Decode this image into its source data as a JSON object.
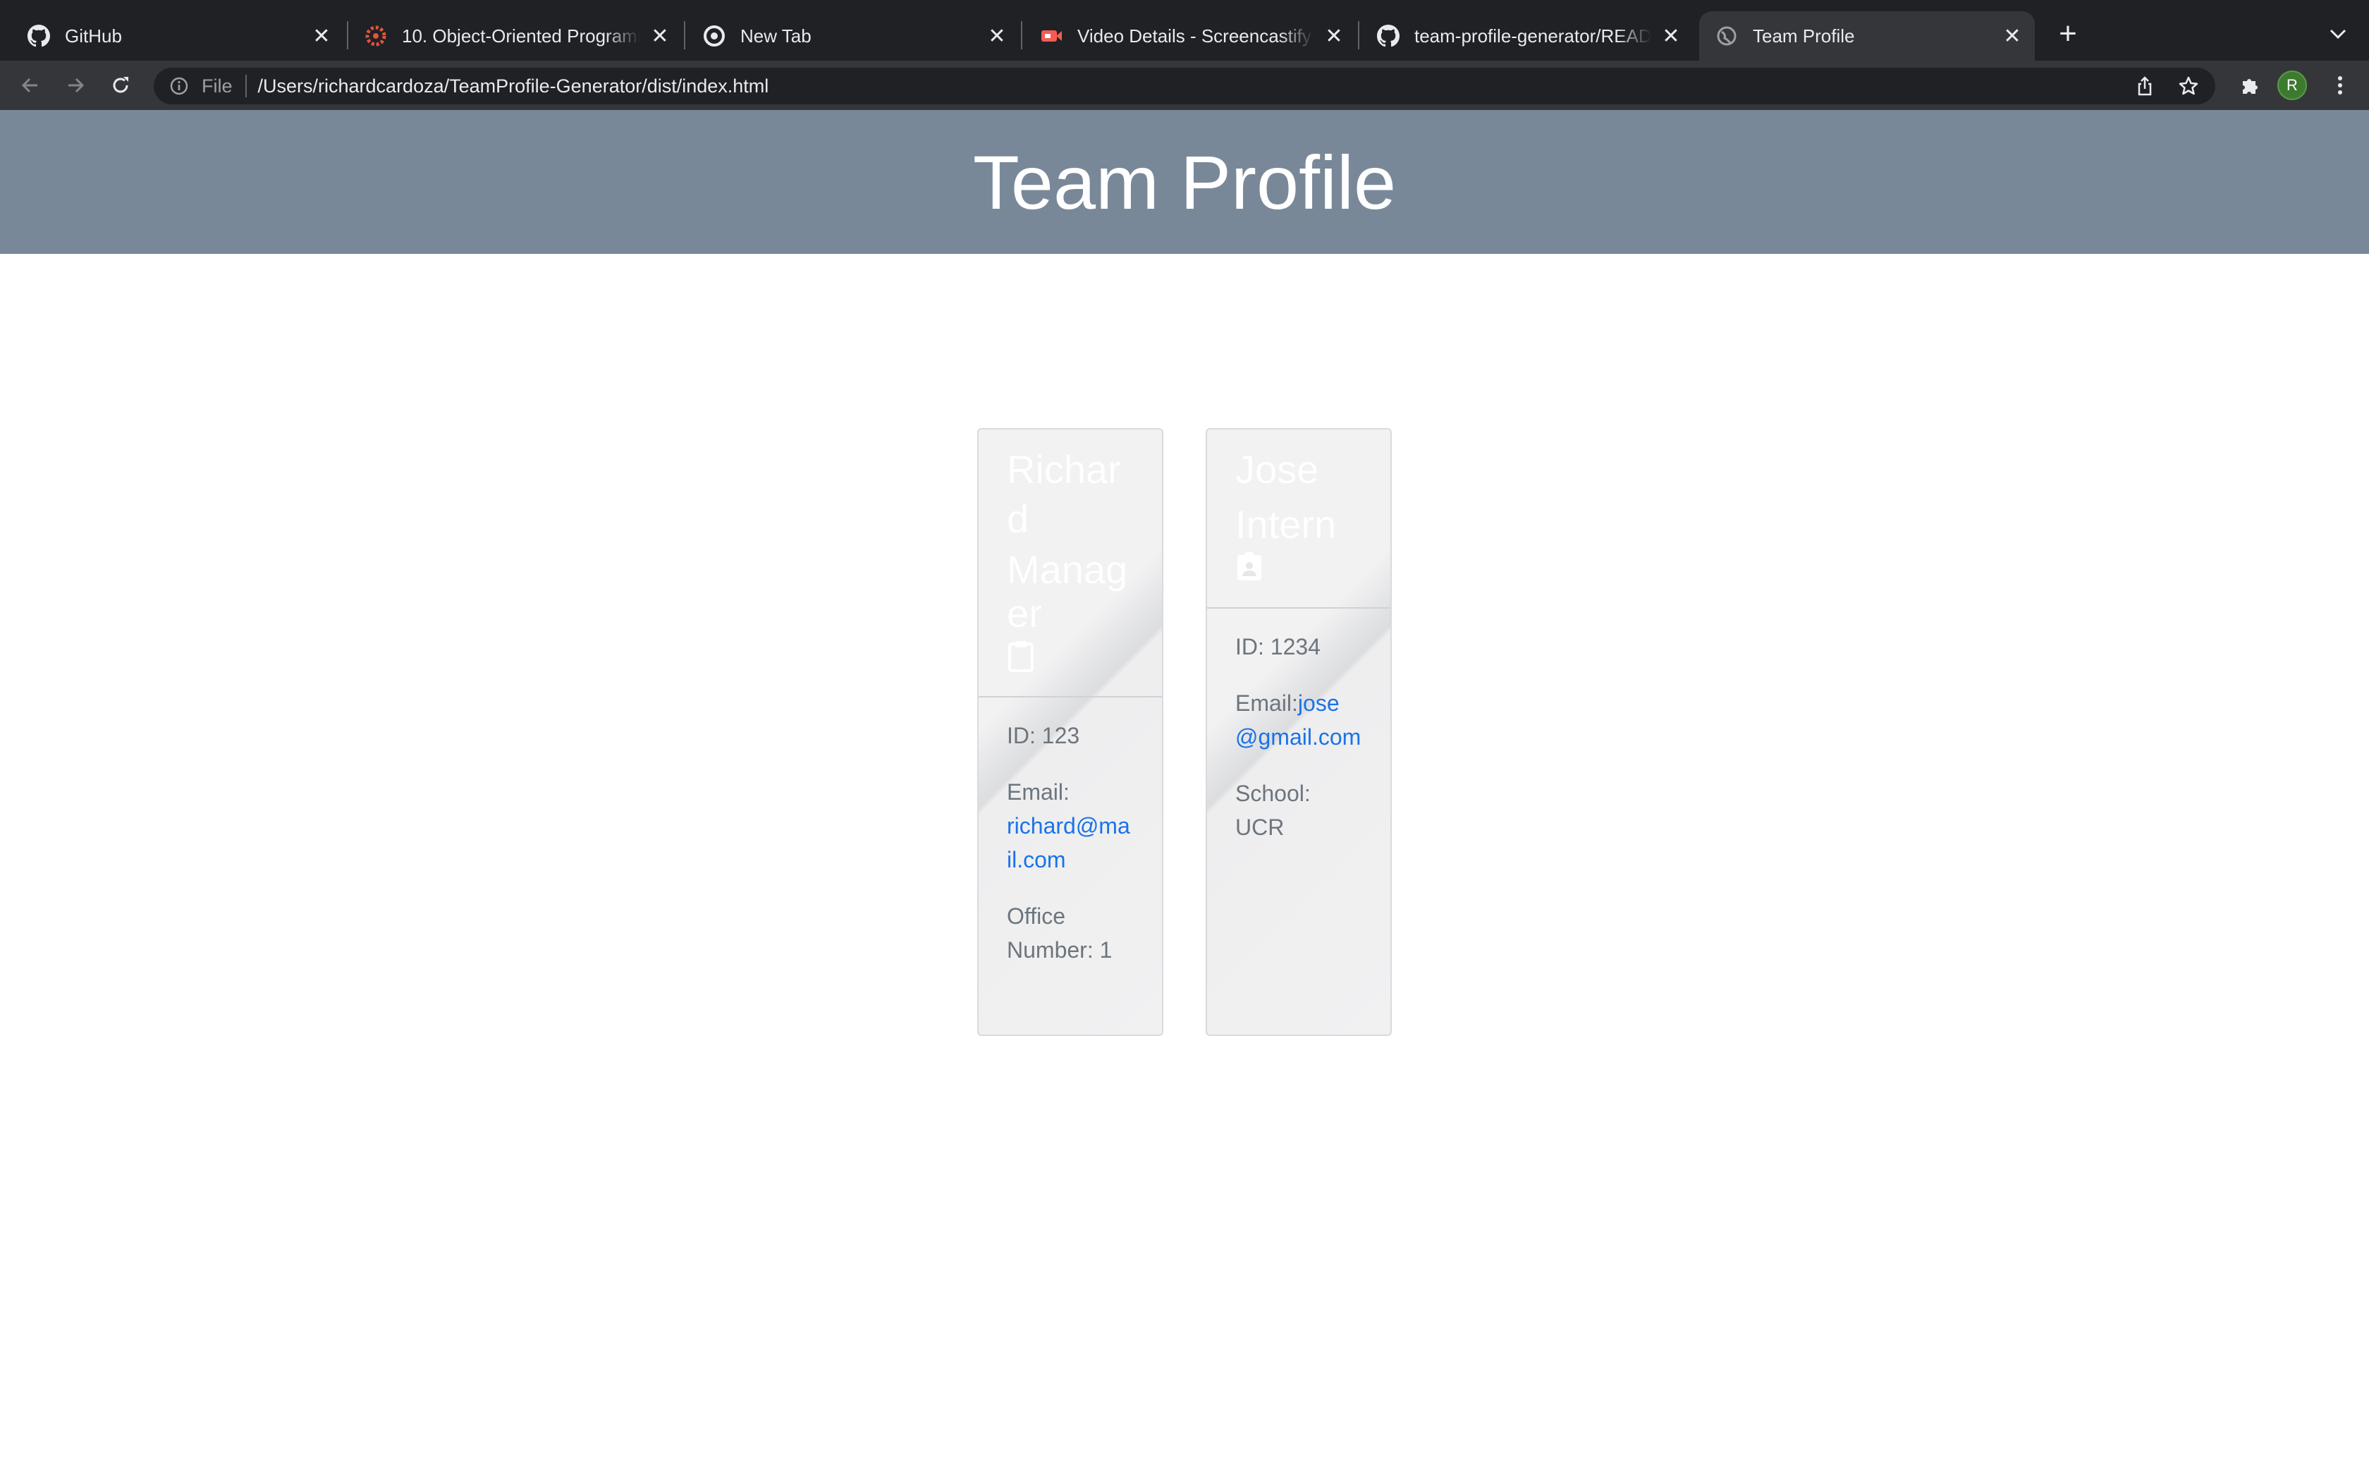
{
  "browser": {
    "tabs": [
      {
        "label": "GitHub",
        "icon": "github-icon",
        "active": false
      },
      {
        "label": "10. Object-Oriented Programming",
        "icon": "bootcamp-icon",
        "active": false
      },
      {
        "label": "New Tab",
        "icon": "chrome-icon",
        "active": false
      },
      {
        "label": "Video Details - Screencastify",
        "icon": "screencastify-icon",
        "active": false
      },
      {
        "label": "team-profile-generator/README.md",
        "icon": "github-icon",
        "active": false
      },
      {
        "label": "Team Profile",
        "icon": "globe-icon",
        "active": true
      }
    ],
    "address": {
      "scheme_label": "File",
      "url": "/Users/richardcardoza/TeamProfile-Generator/dist/index.html"
    },
    "profile_initial": "R",
    "colors": {
      "tabbar": "#202124",
      "toolbar": "#35363a",
      "avatar": "#3c7a2e"
    }
  },
  "page": {
    "title": "Team Profile",
    "header_color": "#798899",
    "cards": [
      {
        "name": "Richard",
        "role": "Manager",
        "role_icon": "clipboard-icon",
        "id_text": "ID: 123",
        "email_label": "Email:",
        "email": "richard@mail.com",
        "extra": "Office Number: 1"
      },
      {
        "name": "Jose",
        "role": "Intern",
        "role_icon": "id-badge-icon",
        "id_text": "ID: 1234",
        "email_label": "Email:",
        "email": "jose@gmail.com",
        "extra": "School: UCR"
      }
    ]
  }
}
